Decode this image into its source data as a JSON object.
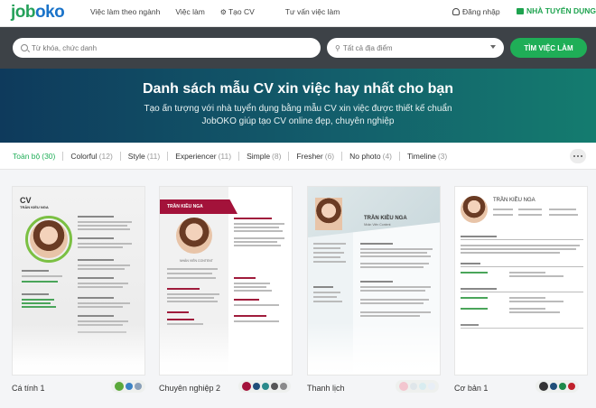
{
  "logo": "joboko",
  "nav": {
    "links": [
      "Việc làm theo ngành",
      "Việc làm",
      "Tạo CV",
      "Tư vấn việc làm"
    ],
    "login": "Đăng nhập",
    "employer": "NHÀ TUYỂN DỤNG"
  },
  "search": {
    "keyword_placeholder": "Từ khóa, chức danh",
    "location_placeholder": "Tất cả địa điểm",
    "button": "TÌM VIỆC LÀM"
  },
  "hero": {
    "title": "Danh sách mẫu CV xin việc hay nhất cho bạn",
    "subtitle_line1": "Tạo ấn tượng với nhà tuyển dụng bằng mẫu CV xin việc được thiết kế chuẩn",
    "subtitle_line2": "JobOKO giúp tạo CV online đẹp, chuyên nghiệp"
  },
  "filters": [
    {
      "label": "Toàn bộ",
      "count": "(30)",
      "active": true
    },
    {
      "label": "Colorful",
      "count": "(12)"
    },
    {
      "label": "Style",
      "count": "(11)"
    },
    {
      "label": "Experiencer",
      "count": "(11)"
    },
    {
      "label": "Simple",
      "count": "(8)"
    },
    {
      "label": "Fresher",
      "count": "(6)"
    },
    {
      "label": "No photo",
      "count": "(4)"
    },
    {
      "label": "Timeline",
      "count": "(3)"
    }
  ],
  "cards": [
    {
      "label": "Cá tính 1",
      "thumb_name": "TRẦN KIỀU NGA",
      "thumb_heading": "CV",
      "swatches": [
        "#5aa83a",
        "#3b82c4",
        "#8aa0b8"
      ]
    },
    {
      "label": "Chuyên nghiệp 2",
      "thumb_name": "TRẦN KIỀU NGA",
      "thumb_role": "NHÂN VIÊN CONTENT",
      "swatches": [
        "#a3123a",
        "#1f4e79",
        "#2a8a8a",
        "#555555",
        "#8a8a8a"
      ]
    },
    {
      "label": "Thanh lịch",
      "thumb_name": "TRẦN KIỀU NGA",
      "thumb_role": "Nhân Viên Content",
      "swatches": [
        "#f3c6cf",
        "#dfe6ea",
        "#d8ecf0",
        "#e8eef6"
      ]
    },
    {
      "label": "Cơ bản 1",
      "thumb_name": "TRẦN KIỀU NGA",
      "swatches": [
        "#333333",
        "#1f4e79",
        "#1e8a4a",
        "#c0212b"
      ]
    }
  ]
}
